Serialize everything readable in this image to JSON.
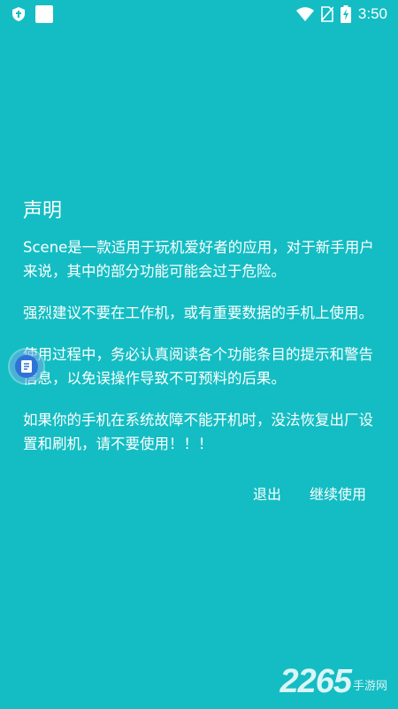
{
  "status_bar": {
    "time": "3:50"
  },
  "dialog": {
    "title": "声明",
    "paragraphs": [
      "Scene是一款适用于玩机爱好者的应用，对于新手用户来说，其中的部分功能可能会过于危险。",
      "强烈建议不要在工作机，或有重要数据的手机上使用。",
      "使用过程中，务必认真阅读各个功能条目的提示和警告信息，以免误操作导致不可预料的后果。",
      "如果你的手机在系统故障不能开机时，没法恢复出厂设置和刷机，请不要使用！！！"
    ],
    "exit_label": "退出",
    "continue_label": "继续使用"
  },
  "watermark": {
    "number": "2265",
    "text": "手游网"
  },
  "colors": {
    "background": "#13bdc3",
    "text": "#ffffff",
    "float_ball": "#2f73d6"
  }
}
